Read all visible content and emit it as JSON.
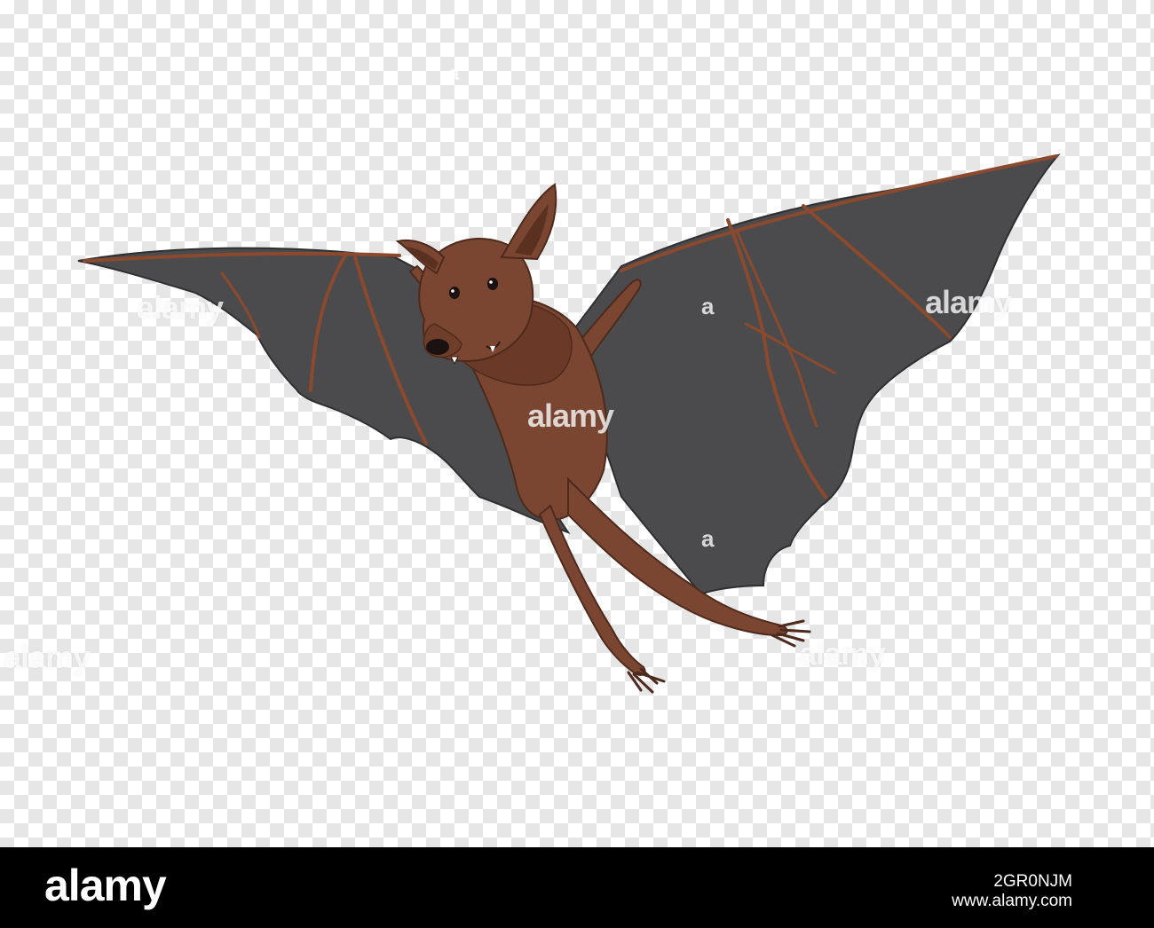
{
  "image": {
    "subject_icon": "bat-illustration",
    "background": "transparency-checkerboard",
    "colors": {
      "wing": "#4a4a4c",
      "wing_bone": "#8a4a30",
      "fur": "#7a4632",
      "fur_dark": "#5a3020",
      "footer": "#000000"
    }
  },
  "watermarks": {
    "brand": "alamy",
    "small": "a"
  },
  "footer": {
    "logo": "alamy",
    "image_id": "2GR0NJM",
    "site": "www.alamy.com"
  }
}
